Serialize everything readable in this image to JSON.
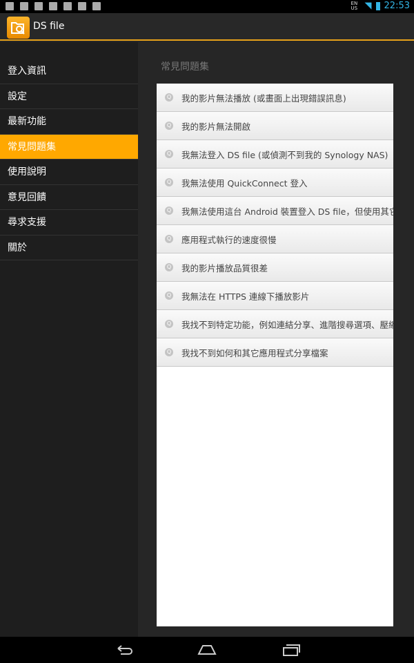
{
  "status": {
    "time": "22:53",
    "lang": "EN US"
  },
  "app": {
    "title": "DS file"
  },
  "sidebar": {
    "items": [
      {
        "label": "登入資訊"
      },
      {
        "label": "設定"
      },
      {
        "label": "最新功能"
      },
      {
        "label": "常見問題集",
        "active": true
      },
      {
        "label": "使用說明"
      },
      {
        "label": "意見回饋"
      },
      {
        "label": "尋求支援"
      },
      {
        "label": "關於"
      }
    ]
  },
  "main": {
    "title": "常見問題集",
    "icon_letter": "Q",
    "faqs": [
      {
        "text": "我的影片無法播放 (或畫面上出現錯誤訊息)"
      },
      {
        "text": "我的影片無法開啟"
      },
      {
        "text": "我無法登入 DS file (或偵測不到我的 Synology NAS)"
      },
      {
        "text": "我無法使用 QuickConnect 登入"
      },
      {
        "text": "我無法使用這台 Android 裝置登入 DS file，但使用其它裝置"
      },
      {
        "text": "應用程式執行的速度很慢"
      },
      {
        "text": "我的影片播放品質很差"
      },
      {
        "text": "我無法在 HTTPS 連線下播放影片"
      },
      {
        "text": "我找不到特定功能，例如連結分享、進階搜尋選項、壓縮 /"
      },
      {
        "text": "我找不到如何和其它應用程式分享檔案"
      }
    ]
  },
  "colors": {
    "accent": "#ffa800",
    "status_blue": "#33b5e5"
  }
}
